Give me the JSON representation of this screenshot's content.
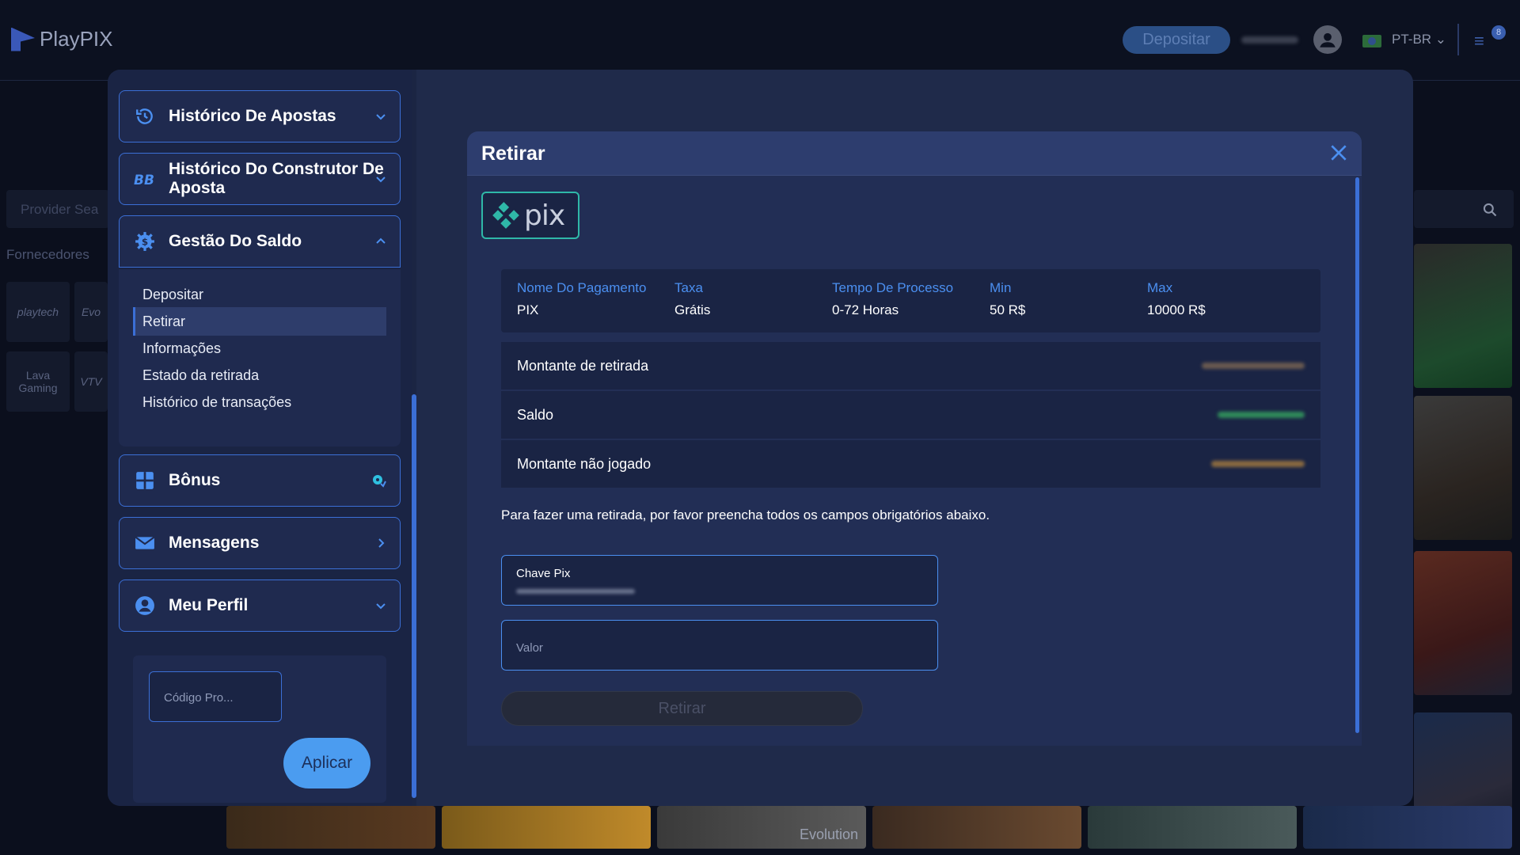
{
  "header": {
    "brand": "PlayPIX",
    "deposit_label": "Depositar",
    "language": "PT-BR",
    "menu_badge": "8"
  },
  "background": {
    "search_placeholder": "Provider Sea",
    "providers_label": "Fornecedores",
    "providers": [
      "playtech",
      "Evo",
      "Lava Gaming",
      "VTV"
    ],
    "tile_texts": [
      "Evolution"
    ]
  },
  "sidebar": {
    "items": [
      {
        "label": "Histórico De Apostas",
        "icon": "history-icon"
      },
      {
        "label": "Histórico Do Construtor De Aposta",
        "icon": "bet-builder-icon"
      },
      {
        "label": "Gestão Do Saldo",
        "icon": "balance-gear-icon"
      },
      {
        "label": "Bônus",
        "icon": "gift-icon"
      },
      {
        "label": "Mensagens",
        "icon": "envelope-icon"
      },
      {
        "label": "Meu Perfil",
        "icon": "user-icon"
      }
    ],
    "balance_submenu": [
      "Depositar",
      "Retirar",
      "Informações",
      "Estado da retirada",
      "Histórico de transações"
    ],
    "active_submenu": "Retirar",
    "promo_placeholder": "Código Pro...",
    "apply_label": "Aplicar"
  },
  "withdraw": {
    "title": "Retirar",
    "method_logo": "pix",
    "table": {
      "headers": [
        "Nome Do Pagamento",
        "Taxa",
        "Tempo De Processo",
        "Min",
        "Max"
      ],
      "values": [
        "PIX",
        "Grátis",
        "0-72 Horas",
        "50 R$",
        "10000 R$"
      ]
    },
    "rows": [
      {
        "label": "Montante de retirada"
      },
      {
        "label": "Saldo"
      },
      {
        "label": "Montante não jogado"
      }
    ],
    "instruction": "Para fazer uma retirada, por favor preencha todos os campos obrigatórios abaixo.",
    "pix_key_label": "Chave Pix",
    "amount_placeholder": "Valor",
    "submit_label": "Retirar"
  },
  "colors": {
    "accent": "#3b6fd6",
    "link_blue": "#4b8ff0",
    "pix_teal": "#2fb8a8",
    "panel_bg": "#222e55",
    "sidebar_bg": "#1a2444"
  }
}
